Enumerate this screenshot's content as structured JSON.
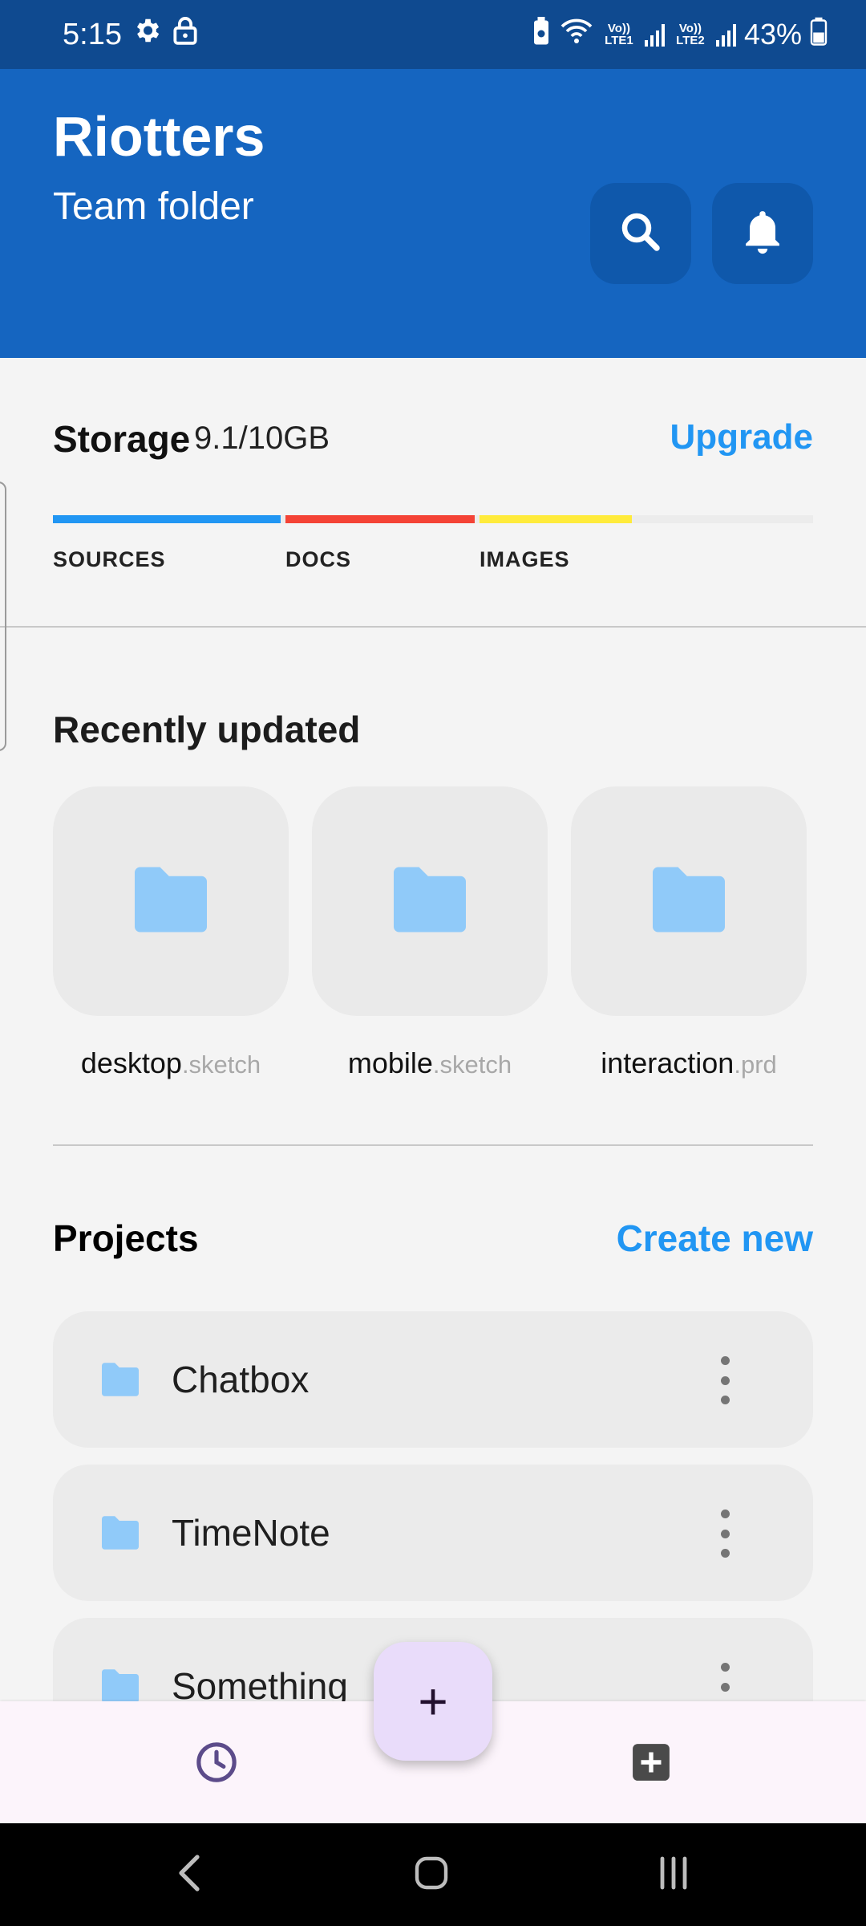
{
  "status_bar": {
    "time": "5:15",
    "network_1": "Vo)) LTE1",
    "network_2": "Vo)) LTE2",
    "battery": "43%"
  },
  "header": {
    "title": "Riotters",
    "subtitle": "Team folder"
  },
  "storage": {
    "title": "Storage",
    "value": "9.1/10GB",
    "upgrade_label": "Upgrade",
    "categories": [
      {
        "label": "SOURCES",
        "color": "#2196f3"
      },
      {
        "label": "DOCS",
        "color": "#f44336"
      },
      {
        "label": "IMAGES",
        "color": "#ffeb3b"
      }
    ]
  },
  "recent": {
    "title": "Recently updated",
    "items": [
      {
        "name": "desktop",
        "ext": ".sketch"
      },
      {
        "name": "mobile",
        "ext": ".sketch"
      },
      {
        "name": "interaction",
        "ext": ".prd"
      }
    ]
  },
  "projects": {
    "title": "Projects",
    "create_label": "Create new",
    "items": [
      {
        "label": "Chatbox"
      },
      {
        "label": "TimeNote"
      },
      {
        "label": "Something"
      }
    ]
  },
  "fab": {
    "label": "+"
  },
  "colors": {
    "status_bar": "#0f4a90",
    "header": "#1565c0",
    "accent": "#2196f3",
    "folder": "#90caf9",
    "fab": "#e9dcfa"
  }
}
